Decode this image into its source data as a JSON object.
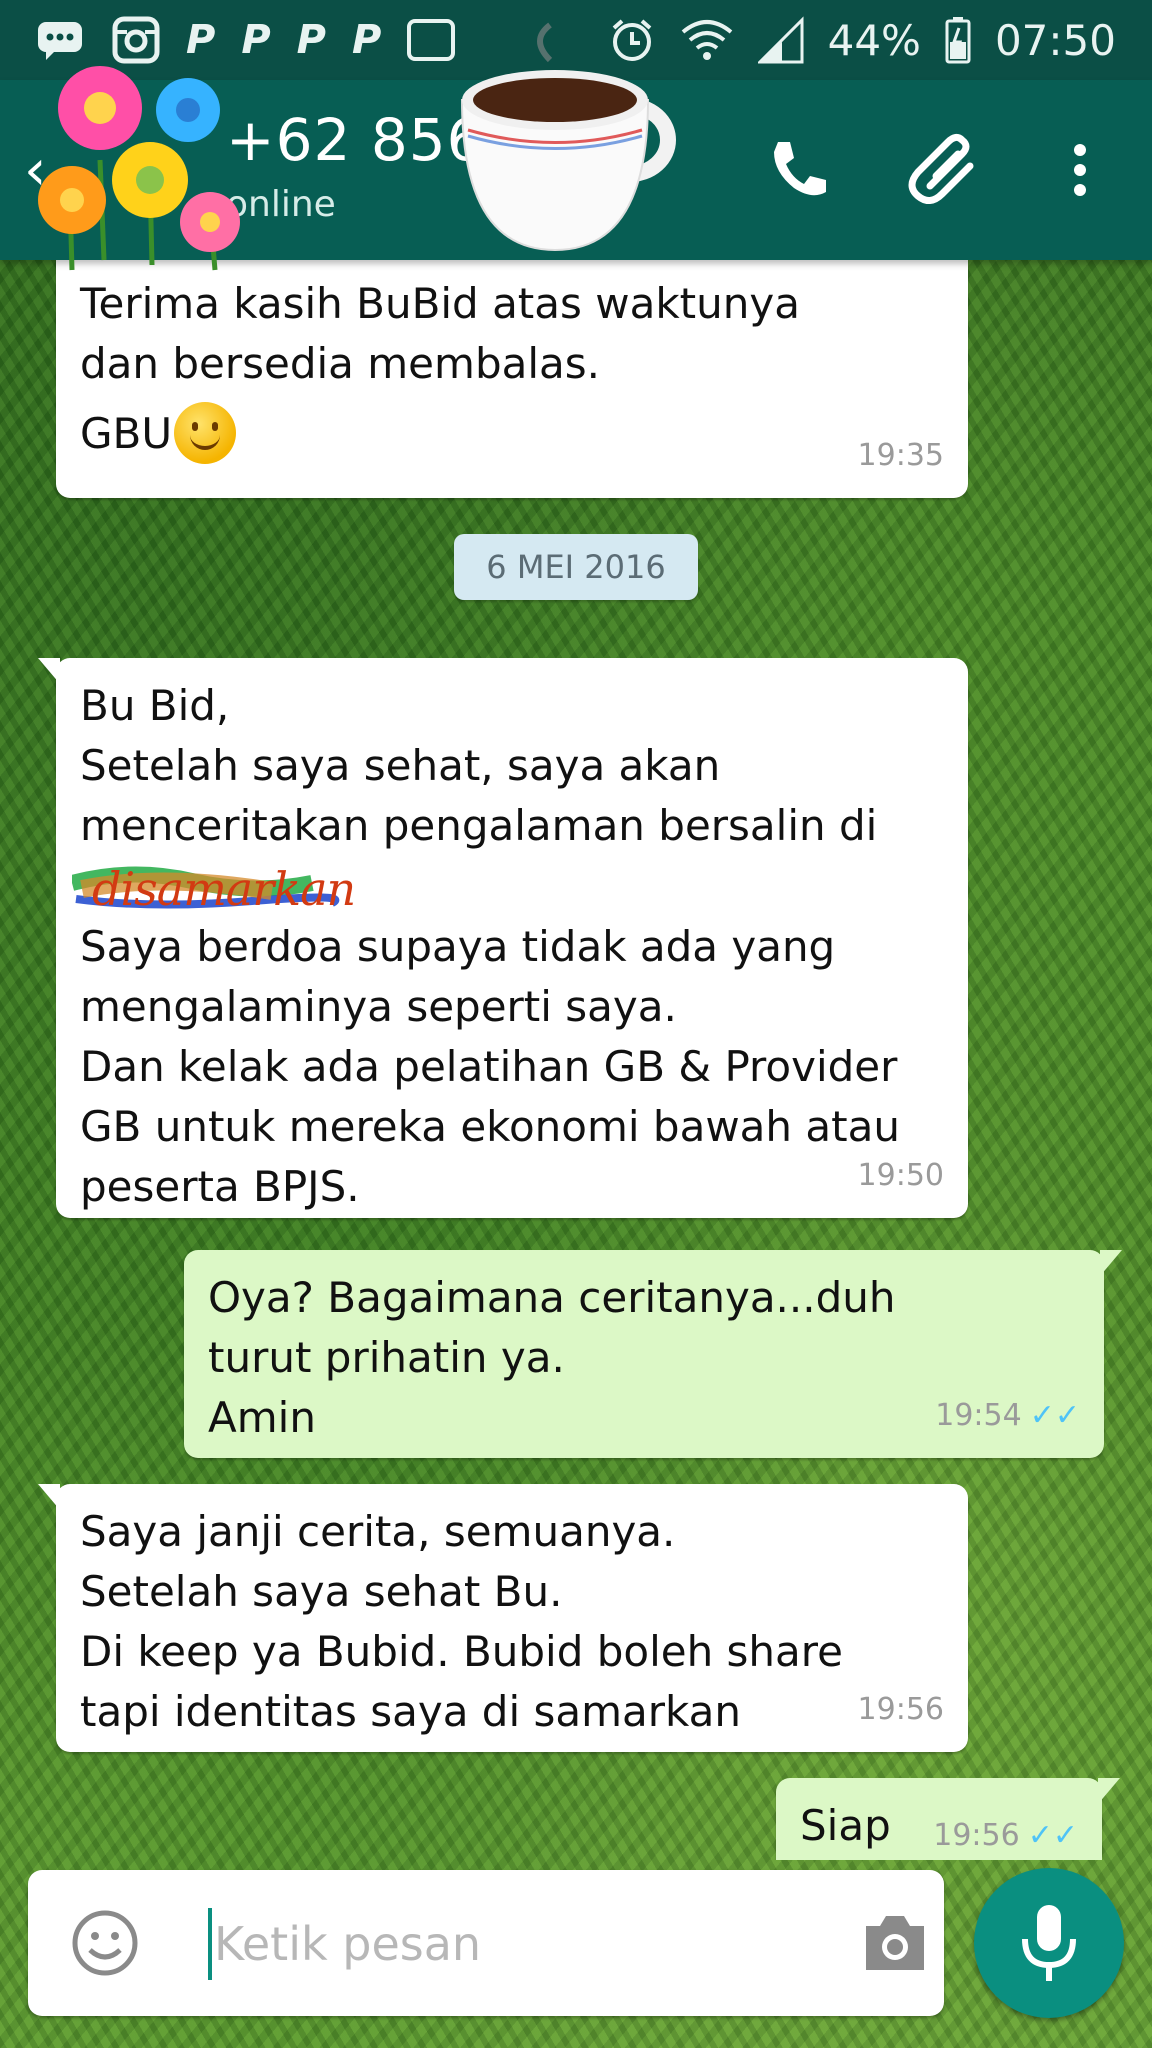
{
  "status_bar": {
    "battery": "44%",
    "time": "07:50"
  },
  "header": {
    "contact_name": "+62 856-2",
    "contact_status": "online"
  },
  "messages": [
    {
      "direction": "in",
      "lines": [
        "Terima kasih BuBid atas waktunya",
        "dan bersedia membalas."
      ],
      "last_line_text": "GBU",
      "time": "19:35"
    },
    {
      "direction": "in",
      "lines": [
        "Bu Bid,",
        "Setelah saya sehat, saya akan",
        "menceritakan pengalaman bersalin di",
        "",
        "Saya berdoa supaya tidak ada yang",
        "mengalaminya seperti saya.",
        "Dan kelak ada pelatihan GB & Provider",
        "GB untuk mereka ekonomi bawah atau",
        "peserta BPJS."
      ],
      "redaction_label": "disamarkan",
      "time": "19:50"
    },
    {
      "direction": "out",
      "lines": [
        "Oya? Bagaimana ceritanya...duh",
        "turut prihatin ya.",
        "Amin"
      ],
      "time": "19:54",
      "status": "read"
    },
    {
      "direction": "in",
      "lines": [
        "Saya janji cerita, semuanya.",
        "Setelah saya sehat Bu.",
        "Di keep ya Bubid. Bubid boleh share",
        "tapi identitas saya di samarkan"
      ],
      "time": "19:56"
    },
    {
      "direction": "out",
      "lines": [
        "Siap"
      ],
      "time": "19:56",
      "status": "read"
    }
  ],
  "date_chip": "6 MEI 2016",
  "composer": {
    "placeholder": "Ketik pesan",
    "value": ""
  },
  "colors": {
    "header": "#075e54",
    "status_bar": "#0b4f46",
    "incoming_bubble": "#ffffff",
    "outgoing_bubble": "#dcf8c6",
    "accent": "#0a8f80",
    "read_ticks": "#4fc3f7"
  },
  "icons": {
    "header": [
      "back-arrow-icon",
      "call-icon",
      "attach-icon",
      "menu-icon"
    ],
    "composer": [
      "emoji-icon",
      "camera-icon",
      "mic-icon"
    ],
    "status": [
      "chat-icon",
      "instagram-icon",
      "pinterest-icon",
      "gallery-icon",
      "alarm-icon",
      "wifi-icon",
      "signal-icon",
      "battery-icon"
    ]
  }
}
